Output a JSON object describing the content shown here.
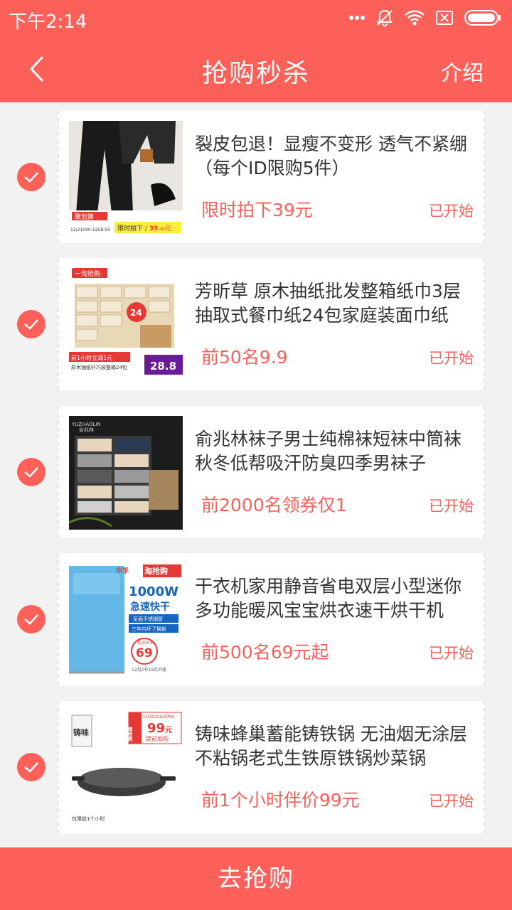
{
  "status": {
    "time": "下午2:14"
  },
  "header": {
    "title": "抢购秒杀",
    "intro_label": "介绍"
  },
  "items": [
    {
      "title": "裂皮包退！显瘦不变形 透气不紧绷（每个ID限购5件）",
      "price": "限时拍下39元",
      "state": "已开始",
      "image_texts": [
        "聚划算",
        "限时拍下 / ",
        "39",
        ".00",
        "元",
        "12/21000-1258:59"
      ]
    },
    {
      "title": "芳昕草 原木抽纸批发整箱纸巾3层抽取式餐巾纸24包家庭装面巾纸",
      "price": "前50名9.9",
      "state": "已开始",
      "image_texts": [
        "一淘抢购",
        "24",
        "前1小时立减1元",
        "原木抽纸纤巧装整箱24包",
        "28.8"
      ]
    },
    {
      "title": "俞兆林袜子男士纯棉袜短袜中筒袜秋冬低帮吸汗防臭四季男袜子",
      "price": "前2000名领券仅1",
      "state": "已开始",
      "image_texts": [
        "YUZHAOLIN",
        "俞兆林"
      ]
    },
    {
      "title": "干衣机家用静音省电双层小型迷你多功能暖风宝宝烘衣速干烘干机",
      "price": "前500名69元起",
      "state": "已开始",
      "image_texts": [
        "华孚",
        "淘抢购",
        "1000W",
        "急速快干",
        "至面不锈钢管",
        "三年内坏了换新",
        "前500名",
        "69",
        "12月2号19点开抢"
      ]
    },
    {
      "title": "铸味蜂巢蓄能铸铁锅 无油烟无涂层不粘锅老式生铁原铁锅炒菜锅",
      "price": "前1个小时伴价99元",
      "state": "已开始",
      "image_texts": [
        "淘抢购",
        "12月02日19点开抢",
        "99",
        "元",
        "提前加购",
        "铸味",
        "仅限前1个小时"
      ]
    }
  ],
  "footer": {
    "button_label": "去抢购"
  },
  "colors": {
    "accent": "#fd6059",
    "text": "#333333"
  }
}
